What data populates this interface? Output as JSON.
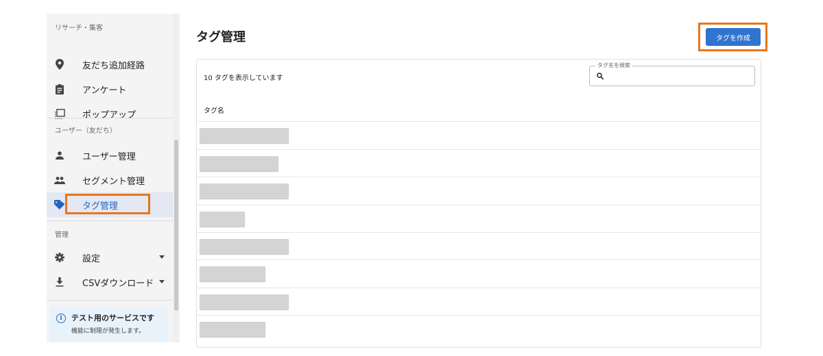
{
  "sidebar": {
    "sections": [
      {
        "label": "リサーチ・集客"
      },
      {
        "label": "ユーザー（友だち）"
      },
      {
        "label": "管理"
      }
    ],
    "items": [
      {
        "label": "友だち追加経路",
        "icon": "location-pin-icon"
      },
      {
        "label": "アンケート",
        "icon": "clipboard-icon"
      },
      {
        "label": "ポップアップ",
        "icon": "popup-icon"
      },
      {
        "label": "ユーザー管理",
        "icon": "person-icon"
      },
      {
        "label": "セグメント管理",
        "icon": "group-icon"
      },
      {
        "label": "タグ管理",
        "icon": "tag-icon",
        "active": true
      },
      {
        "label": "設定",
        "icon": "gear-icon",
        "dropdown": true
      },
      {
        "label": "CSVダウンロード",
        "icon": "download-icon",
        "dropdown": true
      }
    ],
    "notice": {
      "title": "テスト用のサービスです",
      "subtitle": "機能に制限が発生します。"
    }
  },
  "main": {
    "title": "タグ管理",
    "create_button": "タグを作成",
    "count_text": "10 タグを表示しています",
    "search": {
      "legend": "タグ名を検索",
      "value": ""
    },
    "column_header": "タグ名",
    "row_count": 8
  },
  "colors": {
    "accent": "#2f74cf",
    "highlight": "#e8751a",
    "active_bg": "#e3e8f2",
    "notice_bg": "#e8f2fb"
  }
}
